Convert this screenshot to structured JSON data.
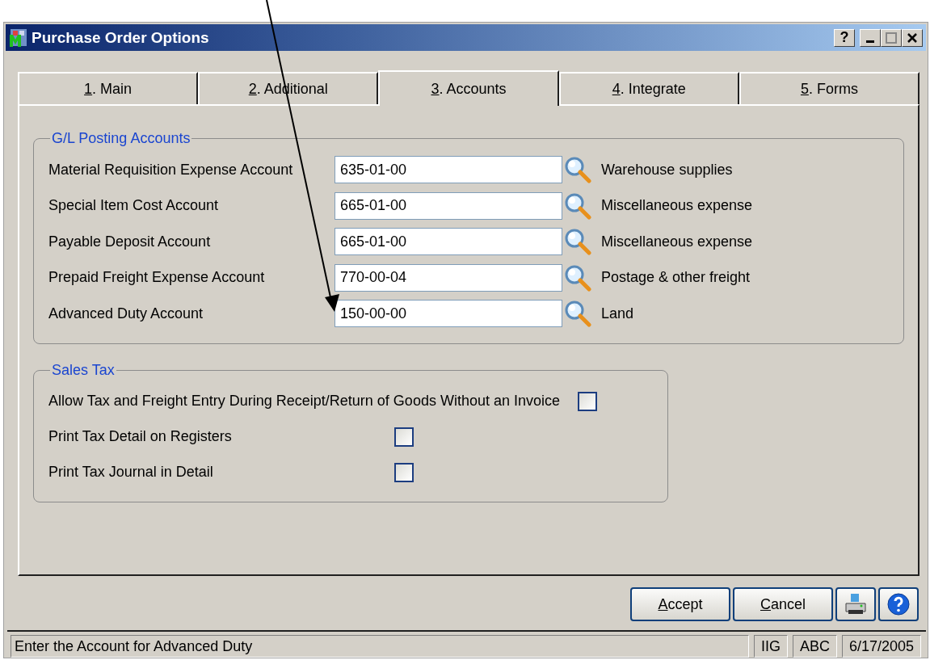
{
  "window": {
    "title": "Purchase Order Options",
    "help_label": "?"
  },
  "tabs": [
    {
      "label": "1. Main",
      "selected": false
    },
    {
      "label": "2. Additional",
      "selected": false
    },
    {
      "label": "3. Accounts",
      "selected": true
    },
    {
      "label": "4. Integrate",
      "selected": false
    },
    {
      "label": "5. Forms",
      "selected": false
    }
  ],
  "gl_posting_accounts": {
    "title": "G/L Posting Accounts",
    "rows": [
      {
        "label": "Material Requisition Expense Account",
        "value": "635-01-00",
        "description": "Warehouse supplies"
      },
      {
        "label": "Special Item Cost Account",
        "value": "665-01-00",
        "description": "Miscellaneous expense"
      },
      {
        "label": "Payable Deposit Account",
        "value": "665-01-00",
        "description": "Miscellaneous expense"
      },
      {
        "label": "Prepaid Freight Expense Account",
        "value": "770-00-04",
        "description": "Postage & other freight"
      },
      {
        "label": "Advanced Duty Account",
        "value": "150-00-00",
        "description": "Land"
      }
    ]
  },
  "sales_tax": {
    "title": "Sales Tax",
    "options": [
      {
        "label": "Allow Tax and Freight Entry During Receipt/Return of Goods Without an Invoice",
        "checked": false
      },
      {
        "label": "Print Tax Detail on Registers",
        "checked": false
      },
      {
        "label": "Print Tax Journal in Detail",
        "checked": false
      }
    ]
  },
  "buttons": [
    {
      "label": "Accept",
      "kind": "text"
    },
    {
      "label": "Cancel",
      "kind": "text"
    },
    {
      "kind": "print"
    },
    {
      "kind": "help"
    }
  ],
  "status_bar": {
    "message": "Enter the Account for Advanced Duty",
    "panels": [
      "IIG",
      "ABC",
      "6/17/2005"
    ]
  }
}
